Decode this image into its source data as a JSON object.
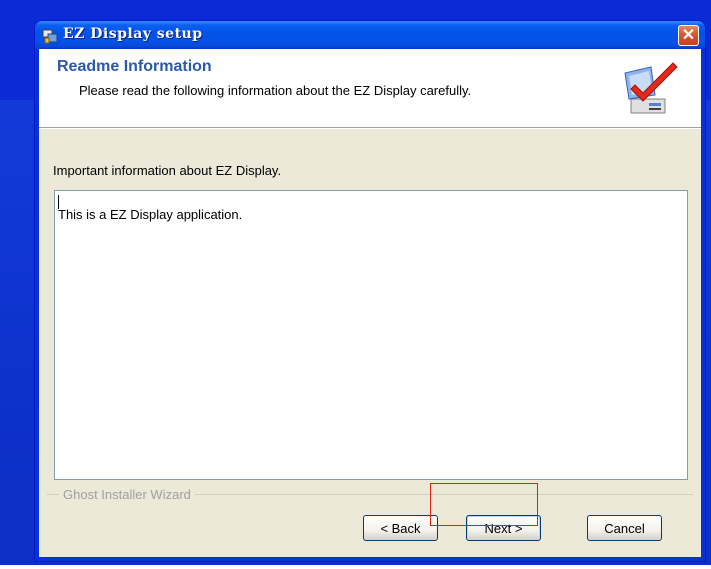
{
  "window": {
    "title": "EZ Display setup",
    "close_label": "✕"
  },
  "header": {
    "title": "Readme Information",
    "subtitle": "Please read the following information about the EZ Display carefully.",
    "graphic": "monitor-checkmark-icon"
  },
  "body": {
    "info_label": "Important information about EZ Display.",
    "readme_text": "This is a EZ Display application."
  },
  "footer": {
    "group_label": "Ghost Installer Wizard",
    "back_label": "< Back",
    "next_label": "Next >",
    "cancel_label": "Cancel"
  },
  "colors": {
    "title_bar": "#0353e9",
    "header_title": "#2c5aa8",
    "highlight": "#e0201b"
  }
}
